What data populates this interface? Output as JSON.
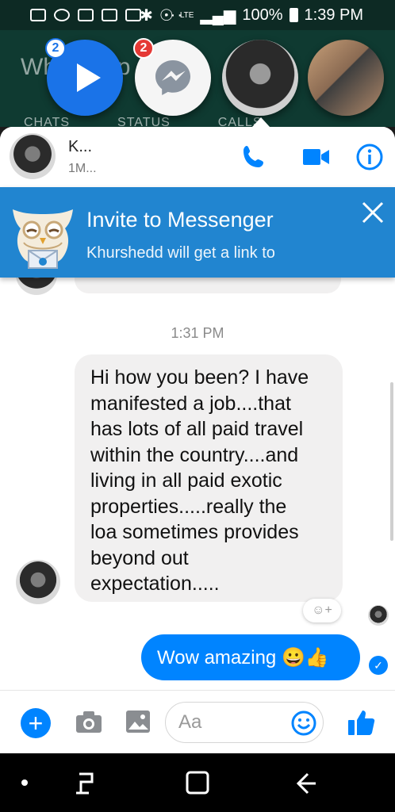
{
  "status_bar": {
    "dots": "···",
    "network_label": "LTE",
    "battery": "100%",
    "time": "1:39 PM"
  },
  "background_app": {
    "title": "WhatsApp",
    "tabs": [
      "CHATS",
      "STATUS",
      "CALLS"
    ]
  },
  "bubble_heads": {
    "play_badge": "2",
    "messenger_badge": "2"
  },
  "header": {
    "name": "K...",
    "subtitle": "1M..."
  },
  "invite": {
    "title": "Invite to Messenger",
    "subtitle": "Khurshedd will get a link to"
  },
  "messages": {
    "timestamp": "1:31 PM",
    "incoming": "Hi how you been? I have\nmanifested a job....that\nhas lots of all paid travel\nwithin the country....and\nliving in all paid exotic\nproperties.....really the\nloa sometimes provides\nbeyond out\nexpectation.....",
    "outgoing": "Wow amazing 😀👍",
    "reaction_label": "☺+"
  },
  "composer": {
    "placeholder": "Aa"
  },
  "colors": {
    "accent": "#0084ff",
    "banner": "#2185d0",
    "badge_red": "#e53935"
  }
}
